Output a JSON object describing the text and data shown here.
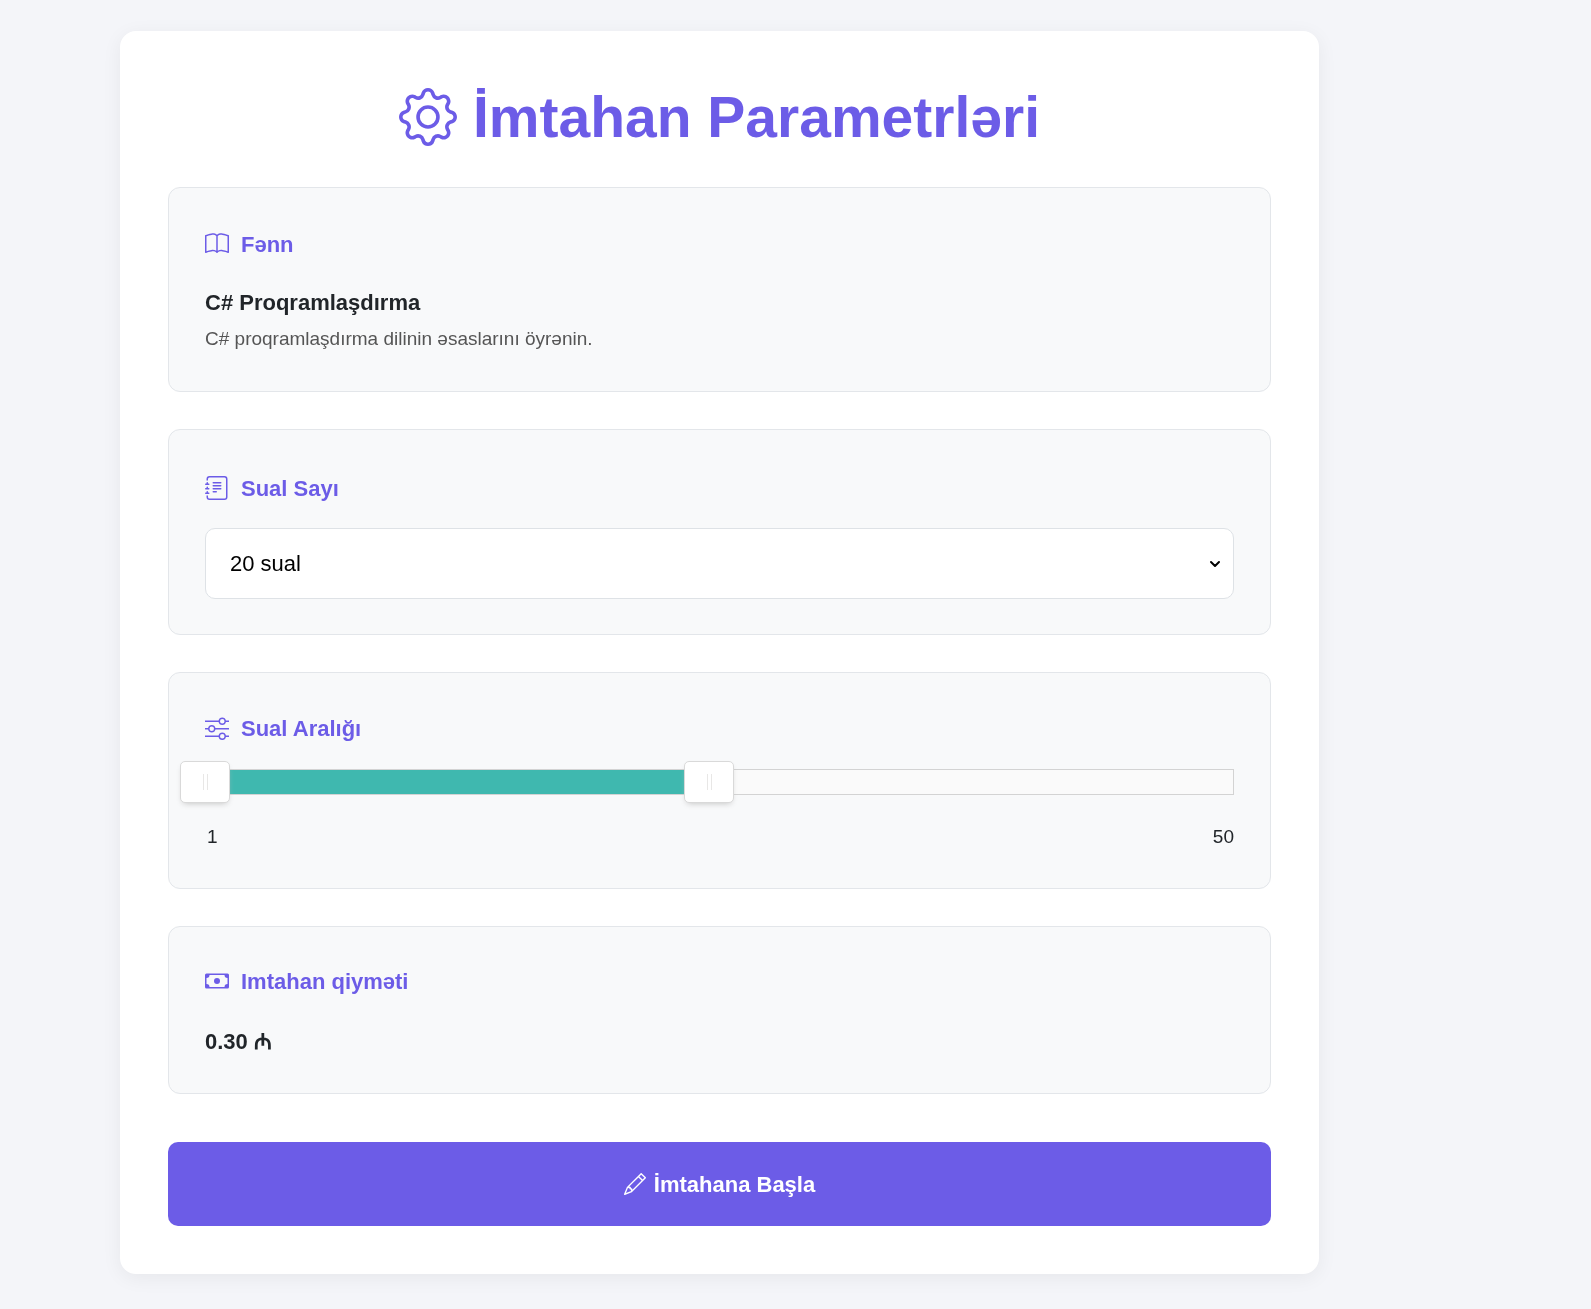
{
  "title": "İmtahan Parametrləri",
  "sections": [
    {
      "kind": "subject",
      "label": "Fənn",
      "name": "C# Proqramlaşdırma",
      "description": "C# proqramlaşdırma dilinin əsaslarını öyrənin."
    },
    {
      "kind": "select",
      "label": "Sual Sayı",
      "value": "20 sual"
    },
    {
      "kind": "range",
      "label": "Sual Aralığı",
      "level": 0.49,
      "min_label": "1",
      "max_label": "50"
    },
    {
      "kind": "price",
      "label": "Imtahan qiyməti",
      "value": "0.30 ₼"
    }
  ],
  "start_button": {
    "label": "İmtahana Başla"
  }
}
